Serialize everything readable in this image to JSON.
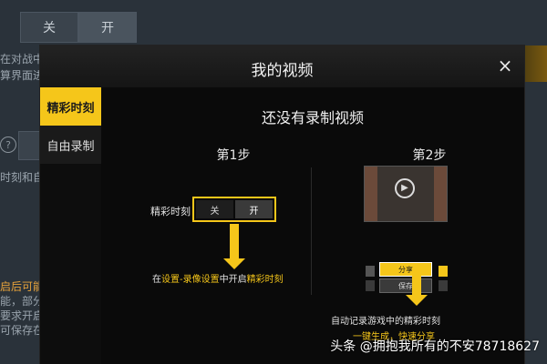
{
  "background": {
    "toggle": {
      "off_label": "关",
      "on_label": "开"
    },
    "text_lines": [
      "在对战中",
      "算界面进",
      "时刻和自",
      "启后可能",
      "能，部分",
      "要求开启",
      "可保存在"
    ],
    "help_icon": "?"
  },
  "modal": {
    "title": "我的视频",
    "close_icon": "×",
    "tabs": [
      {
        "label": "精彩时刻",
        "active": true
      },
      {
        "label": "自由录制",
        "active": false
      }
    ],
    "heading": "还没有录制视频",
    "step1": {
      "label": "第1步",
      "setting_label": "精彩时刻",
      "toggle_off": "关",
      "toggle_on": "开",
      "desc_prefix": "在",
      "desc_link": "设置-录像设置",
      "desc_middle": "中开启",
      "desc_feature": "精彩时刻"
    },
    "step2": {
      "label": "第2步",
      "play_icon": "▶",
      "share_label": "分享",
      "save_label": "保存",
      "desc_line1": "自动记录游戏中的精彩时刻",
      "desc_line2": "一键生成，快速分享"
    }
  },
  "watermark": "头条 @拥抱我所有的不安78718627",
  "colors": {
    "accent": "#f5c61a",
    "modal_bg": "#0d0d0d",
    "page_bg": "#2a323a"
  }
}
